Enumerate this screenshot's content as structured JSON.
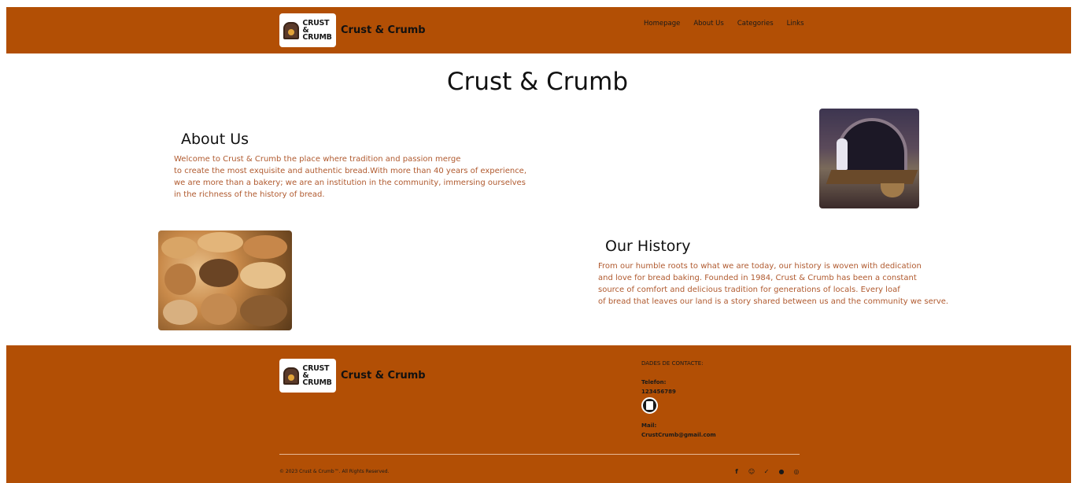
{
  "header": {
    "brand_name": "Crust & Crumb",
    "logo_text": [
      "CRUST",
      "&",
      "CRUMB"
    ],
    "nav": [
      "Homepage",
      "About Us",
      "Categories",
      "Links"
    ]
  },
  "main": {
    "title": "Crust & Crumb",
    "about": {
      "heading": "About Us",
      "lines": [
        "Welcome to Crust & Crumb the place where tradition and passion merge",
        "to create the most exquisite and authentic bread.With more than 40 years of experience,",
        "we are more than a bakery; we are an institution in the community, immersing ourselves",
        "in the richness of the history of bread."
      ]
    },
    "history": {
      "heading": "Our History",
      "lines": [
        "From our humble roots to what we are today, our history is woven with dedication",
        "and love for bread baking. Founded in 1984, Crust & Crumb has been a constant",
        "source of comfort and delicious tradition for generations of locals. Every loaf",
        "of bread that leaves our land is a story shared between us and the community we serve."
      ]
    }
  },
  "footer": {
    "brand_name": "Crust & Crumb",
    "logo_text": [
      "CRUST",
      "&",
      "CRUMB"
    ],
    "contact_heading": "DADES DE CONTACTE:",
    "phone_label": "Telefon:",
    "phone_value": "123456789",
    "mail_label": "Mail:",
    "mail_value": "CrustCrumb@gmail.com",
    "copyright": "© 2023 Crust & Crumb™. All Rights Reserved.",
    "social_icons": [
      "facebook-icon",
      "discord-icon",
      "twitter-icon",
      "github-icon",
      "dribbble-icon"
    ]
  },
  "colors": {
    "brand": "#b24f05",
    "body_text": "#b05a2f",
    "heading": "#111111"
  }
}
